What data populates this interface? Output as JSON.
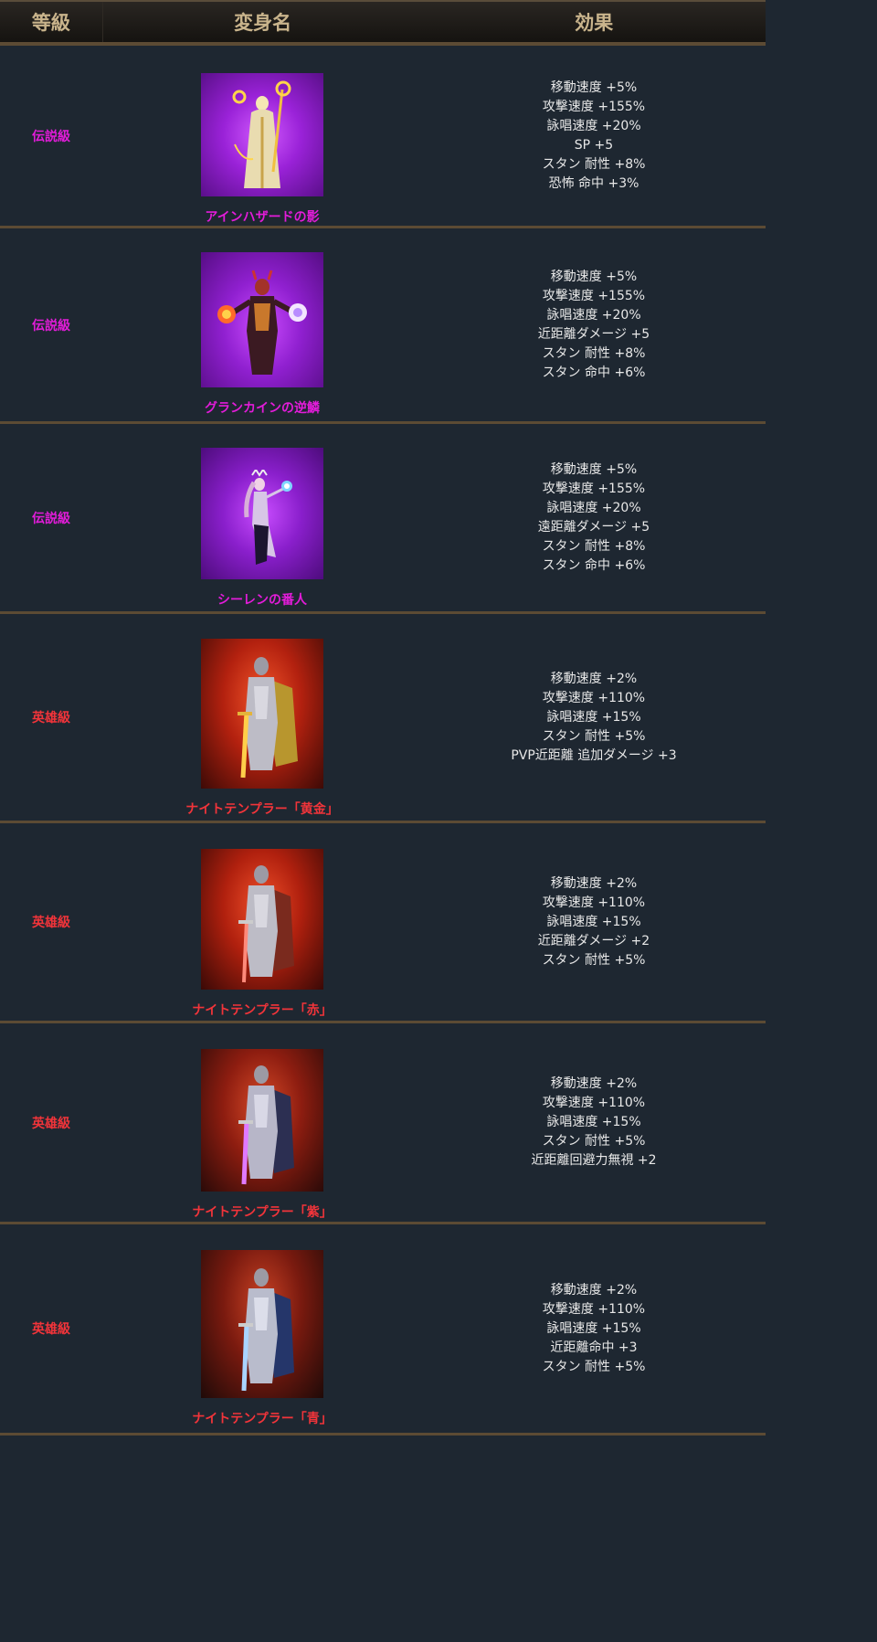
{
  "header": {
    "grade": "等級",
    "name": "変身名",
    "effect": "効果"
  },
  "rows": [
    {
      "grade": "伝説級",
      "name": "アインハザードの影",
      "effects": [
        "移動速度 +5%",
        "攻撃速度 +155%",
        "詠唱速度 +20%",
        "SP +5",
        "スタン 耐性 +8%",
        "恐怖 命中 +3%"
      ]
    },
    {
      "grade": "伝説級",
      "name": "グランカインの逆鱗",
      "effects": [
        "移動速度 +5%",
        "攻撃速度 +155%",
        "詠唱速度 +20%",
        "近距離ダメージ +5",
        "スタン 耐性 +8%",
        "スタン 命中 +6%"
      ]
    },
    {
      "grade": "伝説級",
      "name": "シーレンの番人",
      "effects": [
        "移動速度 +5%",
        "攻撃速度 +155%",
        "詠唱速度 +20%",
        "遠距離ダメージ +5",
        "スタン 耐性 +8%",
        "スタン 命中 +6%"
      ]
    },
    {
      "grade": "英雄級",
      "name": "ナイトテンプラー「黄金」",
      "effects": [
        "移動速度 +2%",
        "攻撃速度 +110%",
        "詠唱速度 +15%",
        "スタン 耐性 +5%",
        "PVP近距離 追加ダメージ +3"
      ]
    },
    {
      "grade": "英雄級",
      "name": "ナイトテンプラー「赤」",
      "effects": [
        "移動速度 +2%",
        "攻撃速度 +110%",
        "詠唱速度 +15%",
        "近距離ダメージ +2",
        "スタン 耐性 +5%"
      ]
    },
    {
      "grade": "英雄級",
      "name": "ナイトテンプラー「紫」",
      "effects": [
        "移動速度 +2%",
        "攻撃速度 +110%",
        "詠唱速度 +15%",
        "スタン 耐性 +5%",
        "近距離回避力無視 +2"
      ]
    },
    {
      "grade": "英雄級",
      "name": "ナイトテンプラー「青」",
      "effects": [
        "移動速度 +2%",
        "攻撃速度 +110%",
        "詠唱速度 +15%",
        "近距離命中 +3",
        "スタン 耐性 +5%"
      ]
    }
  ],
  "colors": {
    "legendary": "#e21cd9",
    "heroic": "#f2343a",
    "header_text": "#c9b48c",
    "row_bg": "#1e2731",
    "border": "#5c4b34"
  }
}
